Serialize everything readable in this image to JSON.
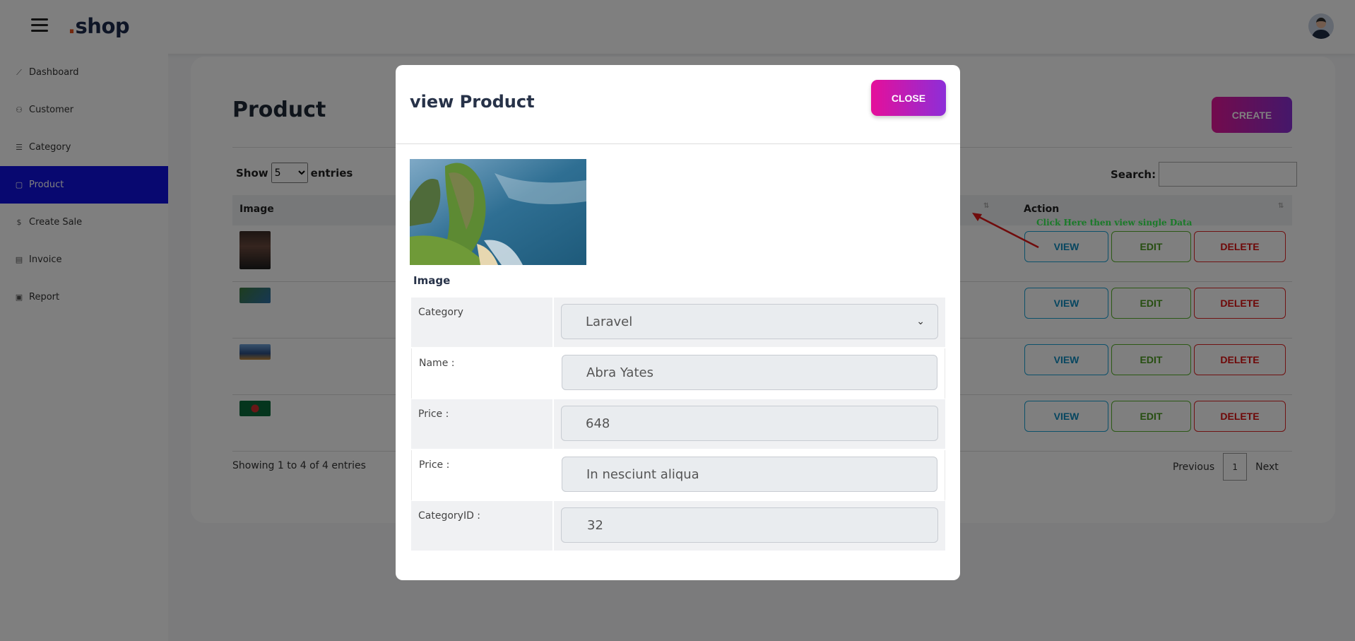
{
  "header": {
    "brand_dot": ".",
    "brand_name": "shop"
  },
  "sidebar": {
    "items": [
      {
        "label": "Dashboard",
        "icon": "chart-line-icon",
        "glyph": "⟋"
      },
      {
        "label": "Customer",
        "icon": "users-icon",
        "glyph": "⚇"
      },
      {
        "label": "Category",
        "icon": "list-icon",
        "glyph": "☰"
      },
      {
        "label": "Product",
        "icon": "bag-icon",
        "glyph": "▢"
      },
      {
        "label": "Create Sale",
        "icon": "dollar-icon",
        "glyph": "$"
      },
      {
        "label": "Invoice",
        "icon": "invoice-icon",
        "glyph": "▤"
      },
      {
        "label": "Report",
        "icon": "report-icon",
        "glyph": "▣"
      }
    ],
    "active_index": 3
  },
  "page": {
    "title": "Product",
    "create_label": "CREATE",
    "show_label": "Show",
    "entries_label": "entries",
    "page_size": "5",
    "search_label": "Search:",
    "columns": {
      "image": "Image",
      "action": "Action"
    },
    "row_actions": {
      "view": "VIEW",
      "edit": "EDIT",
      "delete": "DELETE"
    },
    "showing_text": "Showing 1 to 4 of 4 entries",
    "pager": {
      "previous": "Previous",
      "current": "1",
      "next": "Next"
    },
    "annotation": "Click Here then view single Data"
  },
  "modal": {
    "title": "view Product",
    "close_label": "CLOSE",
    "image_label": "Image",
    "fields": [
      {
        "label": "Category",
        "value": "Laravel",
        "type": "select"
      },
      {
        "label": "Name :",
        "value": "Abra Yates",
        "type": "text"
      },
      {
        "label": "Price :",
        "value": "648",
        "type": "text"
      },
      {
        "label": "Price :",
        "value": "In nesciunt aliqua",
        "type": "text"
      },
      {
        "label": "CategoryID :",
        "value": "32",
        "type": "text"
      }
    ]
  },
  "colors": {
    "accent_gradient_start": "#e6169a",
    "accent_gradient_end": "#8a2fd5",
    "active_nav": "#1010e0",
    "view": "#1aa3d6",
    "edit": "#59b22b",
    "delete": "#e02424",
    "annotation": "#36f553"
  }
}
